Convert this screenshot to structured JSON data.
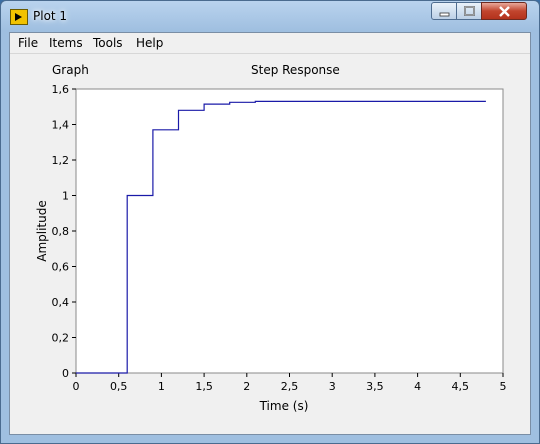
{
  "window": {
    "title": "Plot 1",
    "icon": "labview-vi-icon"
  },
  "title_buttons": {
    "minimize": "minimize-icon",
    "maximize": "maximize-icon",
    "close": "close-icon"
  },
  "menubar": {
    "items": [
      "File",
      "Items",
      "Tools",
      "Help"
    ]
  },
  "graph": {
    "label": "Graph",
    "title": "Step Response"
  },
  "chart_data": {
    "type": "line",
    "title": "Step Response",
    "xlabel": "Time (s)",
    "ylabel": "Amplitude",
    "xlim": [
      0,
      5
    ],
    "ylim": [
      0,
      1.6
    ],
    "x_ticks": [
      "0",
      "0,5",
      "1",
      "1,5",
      "2",
      "2,5",
      "3",
      "3,5",
      "4",
      "4,5",
      "5"
    ],
    "y_ticks": [
      "0",
      "0,2",
      "0,4",
      "0,6",
      "0,8",
      "1",
      "1,2",
      "1,4",
      "1,6"
    ],
    "grid": false,
    "line_color": "#1a1aa8",
    "series": [
      {
        "step": true,
        "x": [
          0,
          0.6,
          0.9,
          1.2,
          1.5,
          1.8,
          2.1,
          2.4,
          4.8
        ],
        "y": [
          0,
          1.0,
          1.37,
          1.48,
          1.515,
          1.525,
          1.53,
          1.53,
          1.53
        ]
      }
    ]
  },
  "colors": {
    "window_frame": "#9fbfe0",
    "client_bg": "#f0f0f0",
    "plot_bg": "#ffffff",
    "close_button": "#c2452e"
  }
}
